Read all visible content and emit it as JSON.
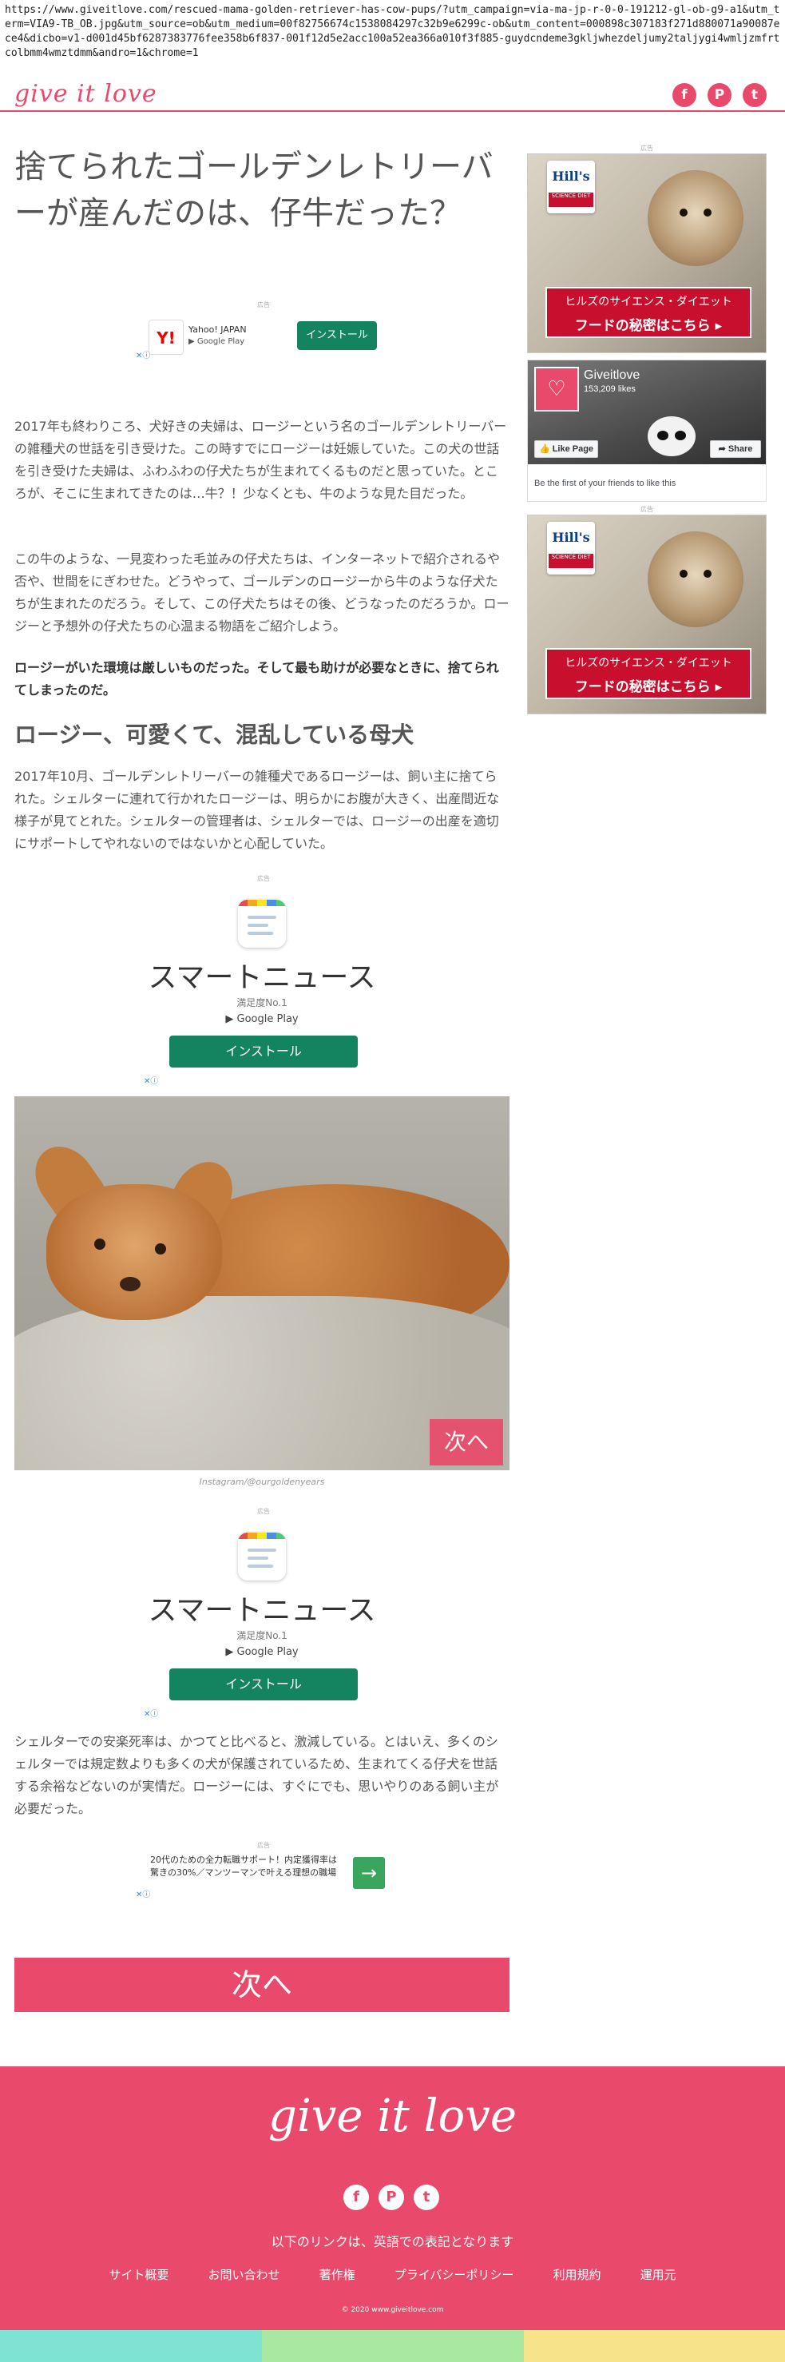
{
  "url": "https://www.giveitlove.com/rescued-mama-golden-retriever-has-cow-pups/?utm_campaign=via-ma-jp-r-0-0-191212-gl-ob-g9-a1&utm_term=VIA9-TB_OB.jpg&utm_source=ob&utm_medium=00f82756674c1538084297c32b9e6299c-ob&utm_content=000898c307183f271d880071a90087ece4&dicbo=v1-d001d45bf6287383776fee358b6f837-001f12d5e2acc100a52ea366a010f3f885-guydcndeme3gkljwhezdeljumy2taljygi4wmljzmfrtcolbmm4wmztdmm&andro=1&chrome=1",
  "header": {
    "logo": "give it love",
    "social": [
      "f",
      "P",
      "t"
    ]
  },
  "article": {
    "title": "捨てられたゴールデンレトリーバーが産んだのは、仔牛だった？",
    "ad_label": "広告",
    "yahoo_ad": {
      "name": "Yahoo! JAPAN",
      "store": "Google Play",
      "install": "インストール"
    },
    "p1": "2017年も終わりころ、犬好きの夫婦は、ロージーという名のゴールデンレトリーバーの雑種犬の世話を引き受けた。この時すでにロージーは妊娠していた。この犬の世話を引き受けた夫婦は、ふわふわの仔犬たちが生まれてくるものだと思っていた。ところが、そこに生まれてきたのは…牛？！少なくとも、牛のような見た目だった。",
    "p2": "この牛のような、一見変わった毛並みの仔犬たちは、インターネットで紹介されるや否や、世間をにぎわせた。どうやって、ゴールデンのロージーから牛のような仔犬たちが生まれたのだろう。そして、この仔犬たちはその後、どうなったのだろうか。ロージーと予想外の仔犬たちの心温まる物語をご紹介しよう。",
    "p3": "ロージーがいた環境は厳しいものだった。そして最も助けが必要なときに、捨てられてしまったのだ。",
    "section_heading": "ロージー、可愛くて、混乱している母犬",
    "p4": "2017年10月、ゴールデンレトリーバーの雑種犬であるロージーは、飼い主に捨てられた。シェルターに連れて行かれたロージーは、明らかにお腹が大きく、出産間近な様子が見てとれた。シェルターの管理者は、シェルターでは、ロージーの出産を適切にサポートしてやれないのではないかと心配していた。",
    "smartnews_ad": {
      "title": "スマートニュース",
      "rating": "満足度No.1",
      "store": "Google Play",
      "install": "インストール"
    },
    "next_overlay": "次へ",
    "photo_credit": "Instagram/@ourgoldenyears",
    "p5": "シェルターでの安楽死率は、かつてと比べると、激減している。とはいえ、多くのシェルターでは規定数よりも多くの犬が保護されているため、生まれてくる仔犬を世話する余裕などないのが実情だ。ロージーには、すぐにでも、思いやりのある飼い主が必要だった。",
    "job_ad": {
      "text": "20代のための全力転職サポート！内定獲得率は驚きの30%／マンツーマンで叶える理想の職場",
      "arrow": "→"
    },
    "big_next": "次へ"
  },
  "sidebar": {
    "ad_label": "広告",
    "hills_ad": {
      "brand": "Hill's",
      "sub": "SCIENCE DIET",
      "cta_line1": "ヒルズのサイエンス・ダイエット",
      "cta_line2": "フードの秘密はこちら ▸"
    },
    "fb": {
      "name": "Giveitlove",
      "likes": "153,209 likes",
      "like_btn": "👍 Like Page",
      "share_btn": "➦ Share",
      "first": "Be the first of your friends to like this"
    }
  },
  "footer": {
    "logo": "give it love",
    "social": [
      "f",
      "P",
      "t"
    ],
    "note": "以下のリンクは、英語での表記となります",
    "links": [
      "サイト概要",
      "お問い合わせ",
      "著作権",
      "プライバシーポリシー",
      "利用規約",
      "運用元"
    ],
    "copyright": "© 2020 www.giveitlove.com"
  },
  "colors": {
    "brand": "#e94a6b",
    "install": "#13845f",
    "stripes": [
      "#7fe3d3",
      "#a8e8a0",
      "#f7e38a"
    ]
  }
}
